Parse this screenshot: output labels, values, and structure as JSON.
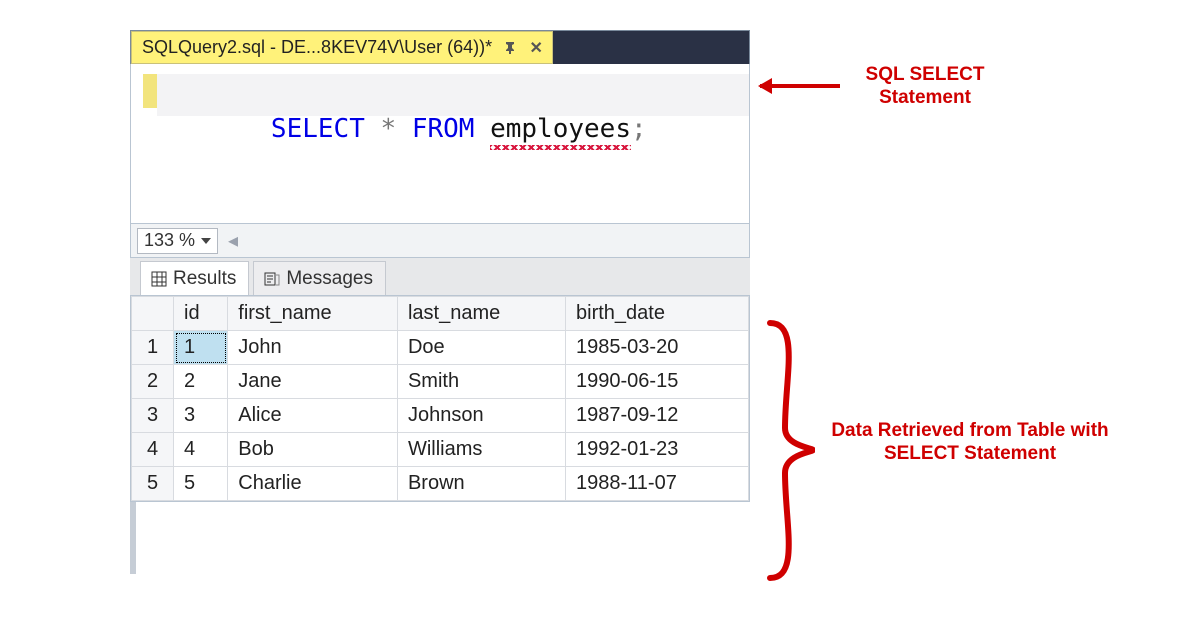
{
  "tab": {
    "title": "SQLQuery2.sql - DE...8KEV74V\\User (64))*"
  },
  "editor": {
    "select_kw": "SELECT",
    "star": "*",
    "from_kw": "FROM",
    "table": "employees",
    "semicolon": ";"
  },
  "zoom": {
    "value": "133 %"
  },
  "result_tabs": {
    "results": "Results",
    "messages": "Messages"
  },
  "grid": {
    "columns": [
      "id",
      "first_name",
      "last_name",
      "birth_date"
    ],
    "rows": [
      {
        "n": "1",
        "id": "1",
        "first_name": "John",
        "last_name": "Doe",
        "birth_date": "1985-03-20"
      },
      {
        "n": "2",
        "id": "2",
        "first_name": "Jane",
        "last_name": "Smith",
        "birth_date": "1990-06-15"
      },
      {
        "n": "3",
        "id": "3",
        "first_name": "Alice",
        "last_name": "Johnson",
        "birth_date": "1987-09-12"
      },
      {
        "n": "4",
        "id": "4",
        "first_name": "Bob",
        "last_name": "Williams",
        "birth_date": "1992-01-23"
      },
      {
        "n": "5",
        "id": "5",
        "first_name": "Charlie",
        "last_name": "Brown",
        "birth_date": "1988-11-07"
      }
    ]
  },
  "annotations": {
    "query": "SQL SELECT Statement",
    "data": "Data Retrieved from Table with SELECT Statement"
  }
}
